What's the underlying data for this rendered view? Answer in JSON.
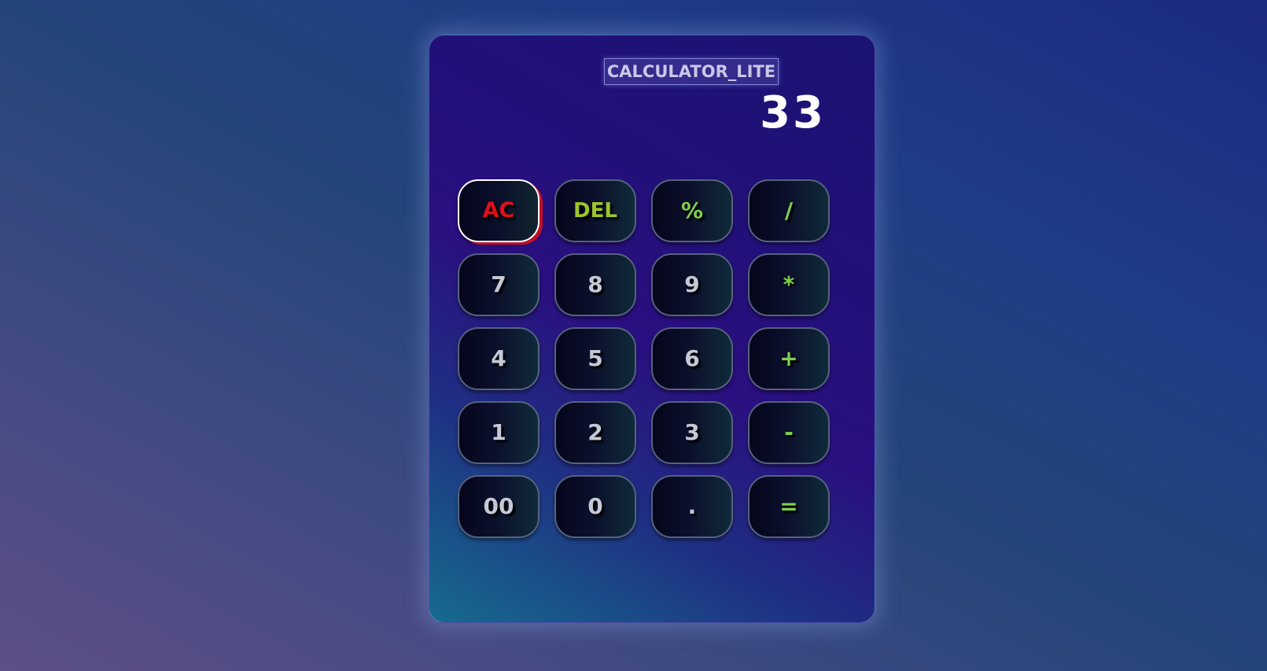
{
  "app": {
    "title": "CALCULATOR_LITE",
    "display_value": "33"
  },
  "keys": [
    {
      "label": "AC",
      "name": "all-clear-button",
      "kind": "ac"
    },
    {
      "label": "DEL",
      "name": "delete-button",
      "kind": "del"
    },
    {
      "label": "%",
      "name": "percent-button",
      "kind": "op"
    },
    {
      "label": "/",
      "name": "divide-button",
      "kind": "op"
    },
    {
      "label": "7",
      "name": "digit-7-button",
      "kind": "num"
    },
    {
      "label": "8",
      "name": "digit-8-button",
      "kind": "num"
    },
    {
      "label": "9",
      "name": "digit-9-button",
      "kind": "num"
    },
    {
      "label": "*",
      "name": "multiply-button",
      "kind": "op"
    },
    {
      "label": "4",
      "name": "digit-4-button",
      "kind": "num"
    },
    {
      "label": "5",
      "name": "digit-5-button",
      "kind": "num"
    },
    {
      "label": "6",
      "name": "digit-6-button",
      "kind": "num"
    },
    {
      "label": "+",
      "name": "add-button",
      "kind": "op"
    },
    {
      "label": "1",
      "name": "digit-1-button",
      "kind": "num"
    },
    {
      "label": "2",
      "name": "digit-2-button",
      "kind": "num"
    },
    {
      "label": "3",
      "name": "digit-3-button",
      "kind": "num"
    },
    {
      "label": "-",
      "name": "subtract-button",
      "kind": "op"
    },
    {
      "label": "00",
      "name": "double-zero-button",
      "kind": "num"
    },
    {
      "label": "0",
      "name": "digit-0-button",
      "kind": "num"
    },
    {
      "label": ".",
      "name": "decimal-point-button",
      "kind": "num"
    },
    {
      "label": "=",
      "name": "equals-button",
      "kind": "op"
    }
  ],
  "colors": {
    "clear_key": "#e0101a",
    "delete_key": "#9bc62b",
    "operator_key": "#7fd04a",
    "number_key": "#c5c9d6",
    "display_text": "#ffffff"
  }
}
